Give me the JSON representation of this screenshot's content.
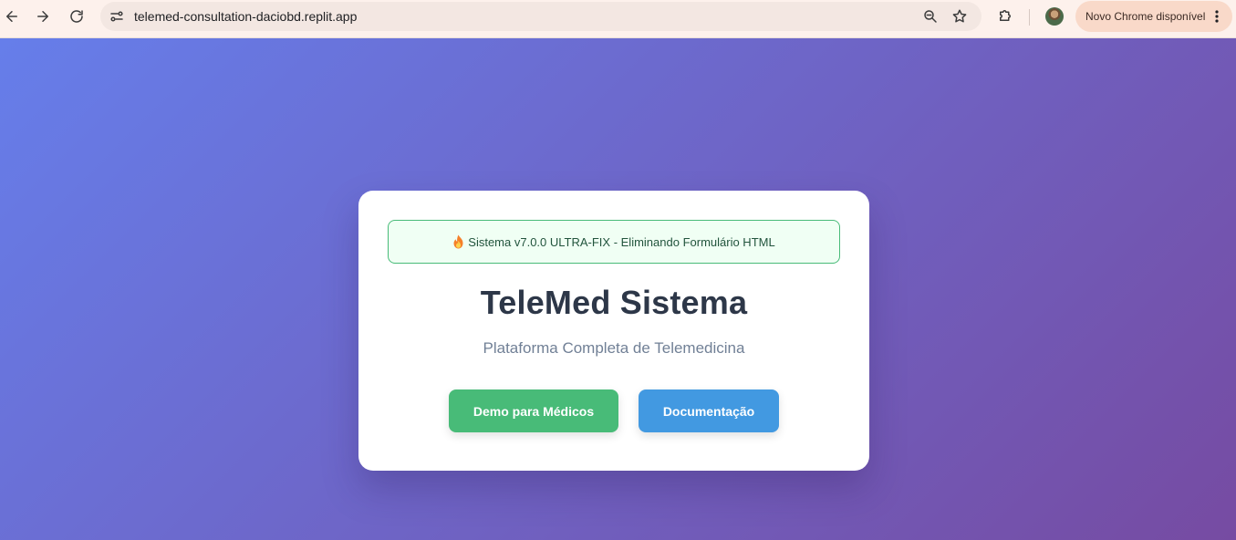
{
  "browser": {
    "url": "telemed-consultation-daciobd.replit.app",
    "update_chip_label": "Novo Chrome disponível",
    "icons": {
      "back": "back-arrow-icon",
      "forward": "forward-arrow-icon",
      "reload": "reload-icon",
      "site_info": "site-info-icon",
      "zoom": "zoom-icon",
      "bookmark": "star-icon",
      "extensions": "puzzle-icon",
      "menu": "kebab-icon"
    }
  },
  "page": {
    "background_gradient": [
      "#667eea",
      "#764ba2"
    ],
    "banner": {
      "icon": "fire-icon",
      "text": "Sistema v7.0.0 ULTRA-FIX - Eliminando Formulário HTML",
      "border_color": "#48bb78",
      "background": "#f0fff4"
    },
    "title": "TeleMed Sistema",
    "subtitle": "Plataforma Completa de Telemedicina",
    "buttons": {
      "demo": {
        "label": "Demo para Médicos",
        "color": "#48bb78"
      },
      "docs": {
        "label": "Documentação",
        "color": "#4299e1"
      }
    }
  }
}
